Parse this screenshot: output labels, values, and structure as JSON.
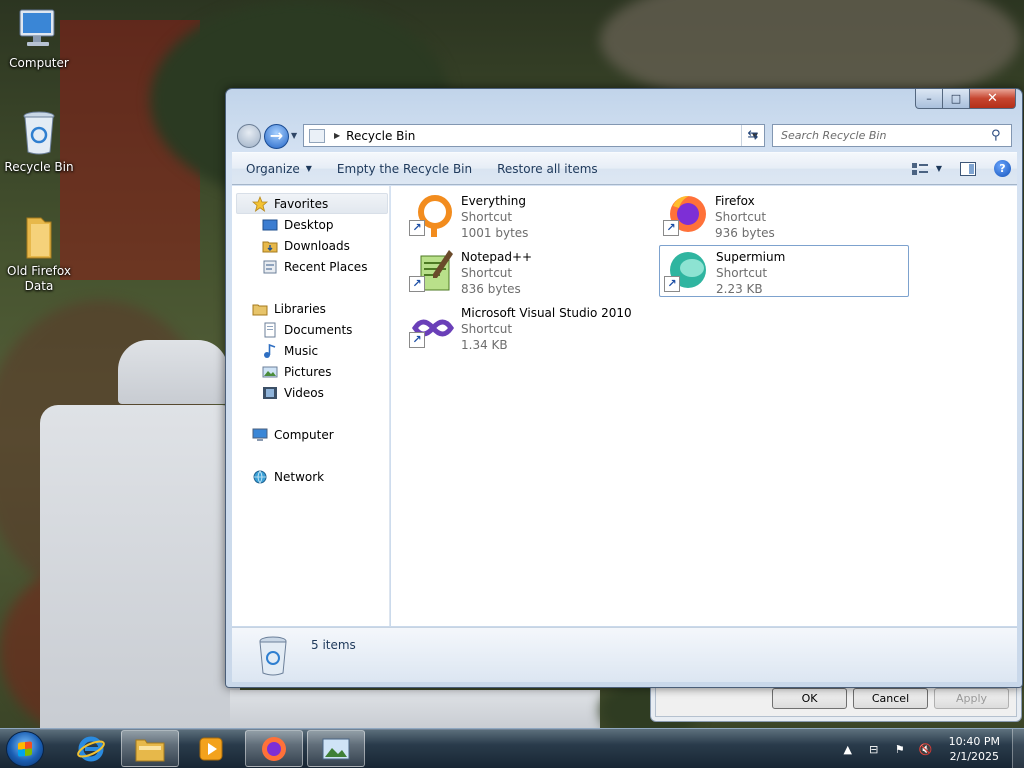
{
  "desktop": {
    "icons": [
      {
        "label": "Computer"
      },
      {
        "label": "Recycle Bin"
      },
      {
        "label": "Old Firefox Data"
      }
    ]
  },
  "window": {
    "caption": {
      "minimize": "–",
      "maximize": "□",
      "close": "✕"
    },
    "address": {
      "path": "Recycle Bin"
    },
    "search": {
      "placeholder": "Search Recycle Bin"
    },
    "commands": {
      "organize": "Organize",
      "empty": "Empty the Recycle Bin",
      "restore": "Restore all items"
    },
    "nav": {
      "favorites": "Favorites",
      "desktop": "Desktop",
      "downloads": "Downloads",
      "recent": "Recent Places",
      "libraries": "Libraries",
      "documents": "Documents",
      "music": "Music",
      "pictures": "Pictures",
      "videos": "Videos",
      "computer": "Computer",
      "network": "Network"
    },
    "files": [
      {
        "name": "Everything",
        "type": "Shortcut",
        "size": "1001 bytes"
      },
      {
        "name": "Firefox",
        "type": "Shortcut",
        "size": "936 bytes"
      },
      {
        "name": "Notepad++",
        "type": "Shortcut",
        "size": "836 bytes"
      },
      {
        "name": "Supermium",
        "type": "Shortcut",
        "size": "2.23 KB"
      },
      {
        "name": "Microsoft Visual Studio 2010",
        "type": "Shortcut",
        "size": "1.34 KB"
      }
    ],
    "details": {
      "count": "5 items"
    }
  },
  "dialog": {
    "ok": "OK",
    "cancel": "Cancel",
    "apply": "Apply"
  },
  "taskbar": {
    "clock": {
      "time": "10:40 PM",
      "date": "2/1/2025"
    }
  },
  "colors": {
    "accent": "#2365c7",
    "selection_border": "#7da2ce",
    "close_button": "#c6452f"
  }
}
